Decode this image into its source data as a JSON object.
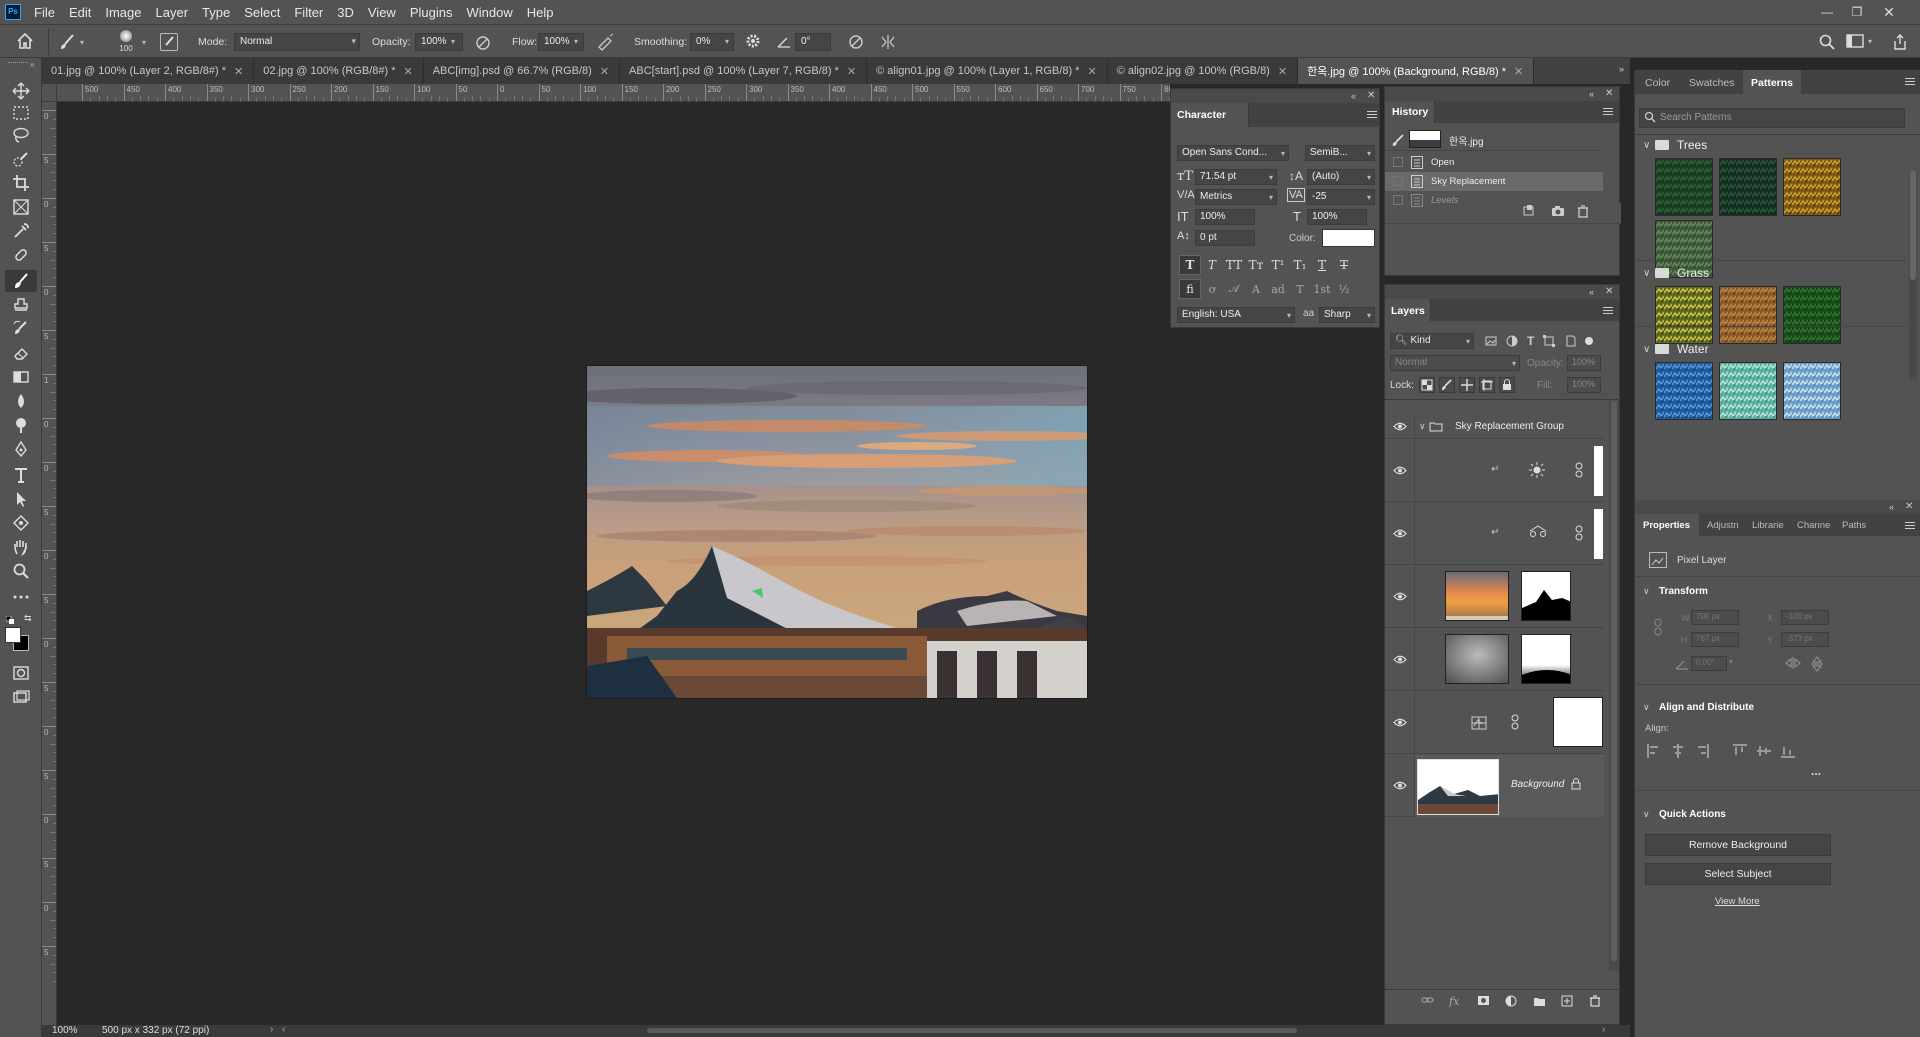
{
  "app": {
    "logo": "Ps"
  },
  "menu": [
    "File",
    "Edit",
    "Image",
    "Layer",
    "Type",
    "Select",
    "Filter",
    "3D",
    "View",
    "Plugins",
    "Window",
    "Help"
  ],
  "options": {
    "brush_size": "100",
    "mode_label": "Mode:",
    "mode_value": "Normal",
    "opacity_label": "Opacity:",
    "opacity_value": "100%",
    "flow_label": "Flow:",
    "flow_value": "100%",
    "smoothing_label": "Smoothing:",
    "smoothing_value": "0%",
    "angle_value": "0°"
  },
  "tabs": [
    {
      "label": "01.jpg @ 100% (Layer 2, RGB/8#) *"
    },
    {
      "label": "02.jpg @ 100% (RGB/8#) *"
    },
    {
      "label": "ABC[img].psd @ 66.7% (RGB/8)"
    },
    {
      "label": "ABC[start].psd @ 100% (Layer 7, RGB/8) *"
    },
    {
      "label": "© align01.jpg @ 100% (Layer 1, RGB/8) *"
    },
    {
      "label": "© align02.jpg @ 100% (RGB/8)"
    },
    {
      "label": "한옥.jpg @ 100% (Background, RGB/8) *"
    }
  ],
  "ruler_h": [
    "500",
    "450",
    "400",
    "350",
    "300",
    "250",
    "200",
    "150",
    "100",
    "50",
    "0",
    "50",
    "100",
    "150",
    "200",
    "250",
    "300",
    "350",
    "400",
    "450",
    "500",
    "550",
    "600",
    "650",
    "700",
    "750",
    "800",
    "850"
  ],
  "ruler_v": [
    "0",
    "5",
    "0",
    "5",
    "0",
    "5",
    "1",
    "0",
    "0",
    "5",
    "0",
    "5",
    "0",
    "5",
    "0",
    "5",
    "0",
    "5",
    "0",
    "5"
  ],
  "status": {
    "zoom": "100%",
    "doc_info": "500 px x 332 px (72 ppi)"
  },
  "character": {
    "title": "Character",
    "font_family": "Open Sans Cond...",
    "font_style": "SemiB...",
    "font_size": "71.54 pt",
    "leading": "(Auto)",
    "kerning": "Metrics",
    "tracking": "-25",
    "vert_scale": "100%",
    "horiz_scale": "100%",
    "baseline": "0 pt",
    "color_label": "Color:",
    "language": "English: USA",
    "antialias": "Sharp",
    "aa_label": "aa"
  },
  "history": {
    "title": "History",
    "snapshot": "한옥.jpg",
    "items": [
      "Open",
      "Sky Replacement",
      "Levels"
    ]
  },
  "layers": {
    "title": "Layers",
    "kind": "Kind",
    "blend": "Normal",
    "opacity_label": "Opacity:",
    "opacity": "100%",
    "lock_label": "Lock:",
    "fill_label": "Fill:",
    "fill": "100%",
    "group_name": "Sky Replacement Group",
    "background_name": "Background"
  },
  "right_tabs": {
    "color": "Color",
    "swatches": "Swatches",
    "patterns": "Patterns"
  },
  "patterns": {
    "search_placeholder": "Search Patterns",
    "groups": [
      "Trees",
      "Grass",
      "Water"
    ]
  },
  "properties_tabs": [
    "Properties",
    "Adjustn",
    "Librarie",
    "Channe",
    "Paths"
  ],
  "properties": {
    "layer_type": "Pixel Layer",
    "transform": "Transform",
    "w_label": "W",
    "w": "700 px",
    "h_label": "H",
    "h": "767 px",
    "x_label": "X",
    "x": "-100 px",
    "y_label": "Y",
    "y": "-373 px",
    "angle": "0.00°",
    "align_title": "Align and Distribute",
    "align_label": "Align:",
    "more": "...",
    "quick_title": "Quick Actions",
    "remove_bg": "Remove Background",
    "select_subject": "Select Subject",
    "view_more": "View More"
  },
  "colors": {
    "accent": "#31a8ff",
    "panel": "#535353",
    "canvas": "#282828"
  }
}
